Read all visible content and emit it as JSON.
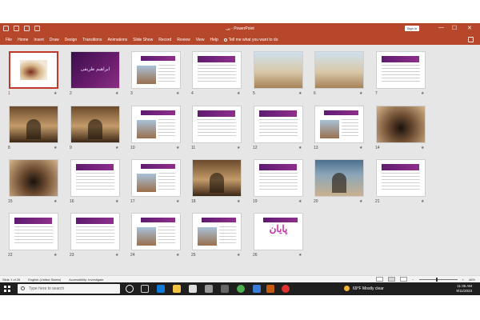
{
  "app": {
    "title": "پی - PowerPoint",
    "sign_in": "Sign in"
  },
  "ribbon": {
    "tabs": [
      "File",
      "Home",
      "Insert",
      "Draw",
      "Design",
      "Transitions",
      "Animations",
      "Slide Show",
      "Record",
      "Review",
      "View",
      "Help"
    ],
    "tell_me": "Tell me what you want to do"
  },
  "slides": [
    {
      "n": "1",
      "kind": "calligraphy",
      "selected": true
    },
    {
      "n": "2",
      "kind": "title",
      "text": "ابراهیم ظریفی"
    },
    {
      "n": "3",
      "kind": "text-image"
    },
    {
      "n": "4",
      "kind": "text"
    },
    {
      "n": "5",
      "kind": "photo-dome"
    },
    {
      "n": "6",
      "kind": "photo-dome"
    },
    {
      "n": "7",
      "kind": "text"
    },
    {
      "n": "8",
      "kind": "photo-interior"
    },
    {
      "n": "9",
      "kind": "photo-interior"
    },
    {
      "n": "10",
      "kind": "text-image"
    },
    {
      "n": "11",
      "kind": "text"
    },
    {
      "n": "12",
      "kind": "text"
    },
    {
      "n": "13",
      "kind": "text-image"
    },
    {
      "n": "14",
      "kind": "photo-arch"
    },
    {
      "n": "15",
      "kind": "photo-arch"
    },
    {
      "n": "16",
      "kind": "text"
    },
    {
      "n": "17",
      "kind": "text-image"
    },
    {
      "n": "18",
      "kind": "photo-interior"
    },
    {
      "n": "19",
      "kind": "text"
    },
    {
      "n": "20",
      "kind": "photo-facade"
    },
    {
      "n": "21",
      "kind": "text"
    },
    {
      "n": "22",
      "kind": "text"
    },
    {
      "n": "23",
      "kind": "text"
    },
    {
      "n": "24",
      "kind": "text-image"
    },
    {
      "n": "25",
      "kind": "text-image"
    },
    {
      "n": "26",
      "kind": "end",
      "text": "پایان"
    }
  ],
  "status": {
    "slide_of": "Slide 1 of 26",
    "language": "English (United States)",
    "accessibility": "Accessibility: Investigate",
    "zoom": "46%"
  },
  "taskbar": {
    "search_placeholder": "Type here to search",
    "weather": "69°F  Mostly clear",
    "time": "11:36 AM",
    "date": "9/11/2023"
  }
}
